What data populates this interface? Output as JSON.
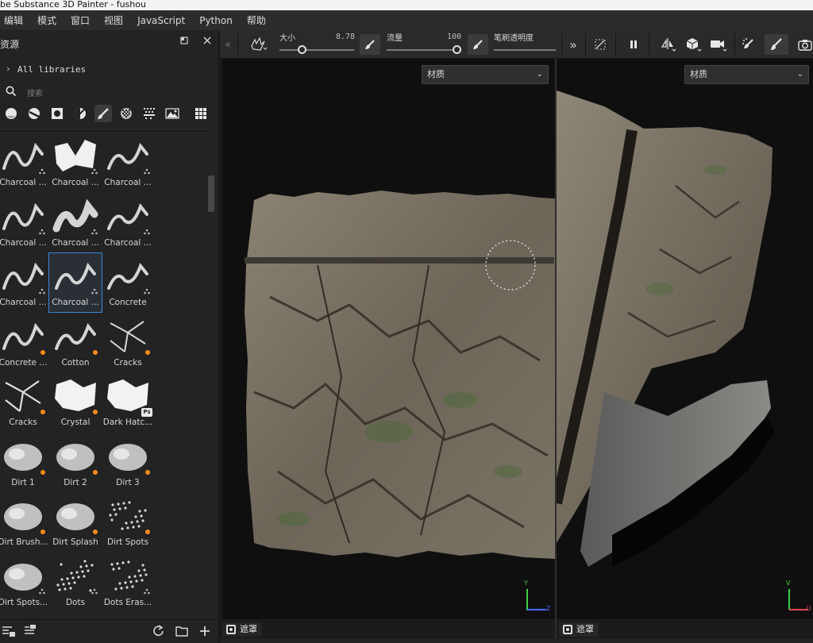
{
  "window": {
    "title": "be Substance 3D Painter - fushou"
  },
  "menu": [
    "编辑",
    "模式",
    "窗口",
    "视图",
    "JavaScript",
    "Python",
    "帮助"
  ],
  "assets_panel": {
    "title": "资源",
    "float_icon": "float-window-icon",
    "close_icon": "close-icon",
    "library_label": "All libraries",
    "search_placeholder": "搜索",
    "filters": [
      "materials-icon",
      "smart-materials-icon",
      "smart-masks-icon",
      "procedurals-icon",
      "brushes-icon",
      "alphas-icon",
      "particles-icon",
      "environments-icon",
      "grid-view-icon"
    ],
    "active_filter": "brushes-icon",
    "tiles": [
      {
        "label": "Charcoal ...",
        "badge": "none"
      },
      {
        "label": "Charcoal ...",
        "badge": "none"
      },
      {
        "label": "Charcoal ...",
        "badge": "none"
      },
      {
        "label": "Charcoal ...",
        "badge": "none"
      },
      {
        "label": "Charcoal ...",
        "badge": "none"
      },
      {
        "label": "Charcoal ...",
        "badge": "none"
      },
      {
        "label": "Charcoal ...",
        "badge": "none"
      },
      {
        "label": "Charcoal ...",
        "badge": "none",
        "selected": true
      },
      {
        "label": "Concrete",
        "badge": "none"
      },
      {
        "label": "Concrete ...",
        "badge": "orange"
      },
      {
        "label": "Cotton",
        "badge": "orange"
      },
      {
        "label": "Cracks",
        "badge": "orange"
      },
      {
        "label": "Cracks",
        "badge": "orange"
      },
      {
        "label": "Crystal",
        "badge": "orange"
      },
      {
        "label": "Dark Hatc...",
        "badge": "ps"
      },
      {
        "label": "Dirt 1",
        "badge": "orange"
      },
      {
        "label": "Dirt 2",
        "badge": "orange"
      },
      {
        "label": "Dirt 3",
        "badge": "orange"
      },
      {
        "label": "Dirt Brush...",
        "badge": "orange"
      },
      {
        "label": "Dirt Splash",
        "badge": "orange"
      },
      {
        "label": "Dirt Spots",
        "badge": "orange"
      },
      {
        "label": "Dirt Spots...",
        "badge": "none"
      },
      {
        "label": "Dots",
        "badge": "none"
      },
      {
        "label": "Dots Eras...",
        "badge": "none"
      }
    ],
    "footer_icons": [
      "import-icon",
      "export-icon",
      "refresh-icon",
      "folder-icon",
      "add-icon"
    ]
  },
  "toolbar": {
    "size_label": "大小",
    "size_value": "8.78",
    "flow_label": "流量",
    "flow_value": "100",
    "opacity_label": "笔刷透明度",
    "size_fraction": 0.3,
    "flow_fraction": 1.0,
    "opacity_fraction": 1.0
  },
  "viewport_left": {
    "dropdown": "材质",
    "mask_label": "遮罩",
    "axis_y": "Y",
    "axis_z": "Z"
  },
  "viewport_right": {
    "dropdown": "材质",
    "mask_label": "遮罩",
    "axis_y": "V",
    "axis_x": "U"
  },
  "colors": {
    "accent": "#3a86d6",
    "badge_orange": "#ff8c1a",
    "axis_green": "#3fd13f",
    "axis_blue": "#4a6cff",
    "axis_red": "#e04a4a"
  }
}
